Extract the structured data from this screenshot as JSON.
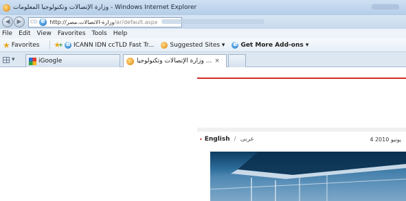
{
  "browser": {
    "title": "وزارة الإتصالات وتكنولوجيا المعلومات - Windows Internet Explorer",
    "address": {
      "prefix": "CD",
      "host": "http://وزارة-الاتصالات.مصر",
      "path": "/ar/default.aspx"
    },
    "nav_icons": [
      "back-icon",
      "forward-icon"
    ]
  },
  "menu": [
    {
      "label": "File"
    },
    {
      "label": "Edit"
    },
    {
      "label": "View"
    },
    {
      "label": "Favorites"
    },
    {
      "label": "Tools"
    },
    {
      "label": "Help"
    }
  ],
  "favorites_bar": {
    "favorites_label": "Favorites",
    "items": [
      {
        "label": "ICANN IDN ccTLD Fast Tr...",
        "icon": "ie-icon"
      },
      {
        "label": "Suggested Sites ▾",
        "icon": "ie-orange-icon"
      },
      {
        "label": "Get More Add-ons ▾",
        "icon": "ie-icon"
      }
    ]
  },
  "tabs": {
    "quick_tabs_caret": "▾",
    "items": [
      {
        "label": "iGoogle",
        "icon": "google-icon",
        "active": false
      },
      {
        "label": "وزارة الإتصالات وتكنولوجيا ...",
        "icon": "ie-orange-icon",
        "active": true
      }
    ],
    "close_glyph": "×"
  },
  "page": {
    "languages": {
      "english": "English",
      "separator": "/",
      "arabic": "عربى"
    },
    "date": "4 يونيو 2010",
    "bullet": "•"
  },
  "colors": {
    "accent_red": "#cf2a1f",
    "titlebar": "#cfe0f2"
  }
}
